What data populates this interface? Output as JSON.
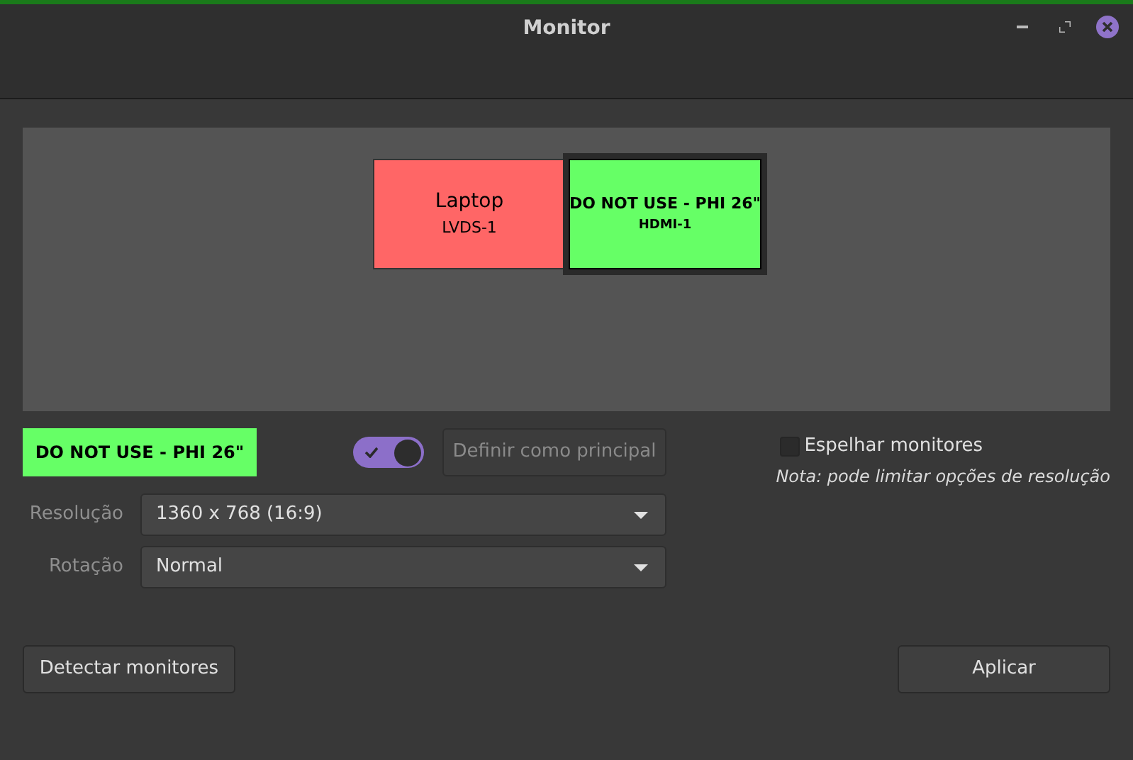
{
  "window": {
    "title": "Monitor"
  },
  "monitors": [
    {
      "name": "Laptop",
      "output": "LVDS-1",
      "color": "#ff6666",
      "selected": false
    },
    {
      "name": "DO NOT USE - PHI 26\"",
      "output": "HDMI-1",
      "color": "#66ff66",
      "selected": true
    }
  ],
  "selected_monitor": {
    "label": "DO NOT USE - PHI 26\"",
    "color": "#66ff66",
    "enabled": true
  },
  "primary_button": {
    "label": "Definir como principal",
    "disabled": true
  },
  "mirror": {
    "label": "Espelhar monitores",
    "checked": false,
    "note": "Nota: pode limitar opções de resolução"
  },
  "fields": [
    {
      "label": "Resolução",
      "value": "1360 x 768 (16:9)"
    },
    {
      "label": "Rotação",
      "value": "Normal"
    }
  ],
  "buttons": {
    "detect": "Detectar monitores",
    "apply": "Aplicar"
  }
}
